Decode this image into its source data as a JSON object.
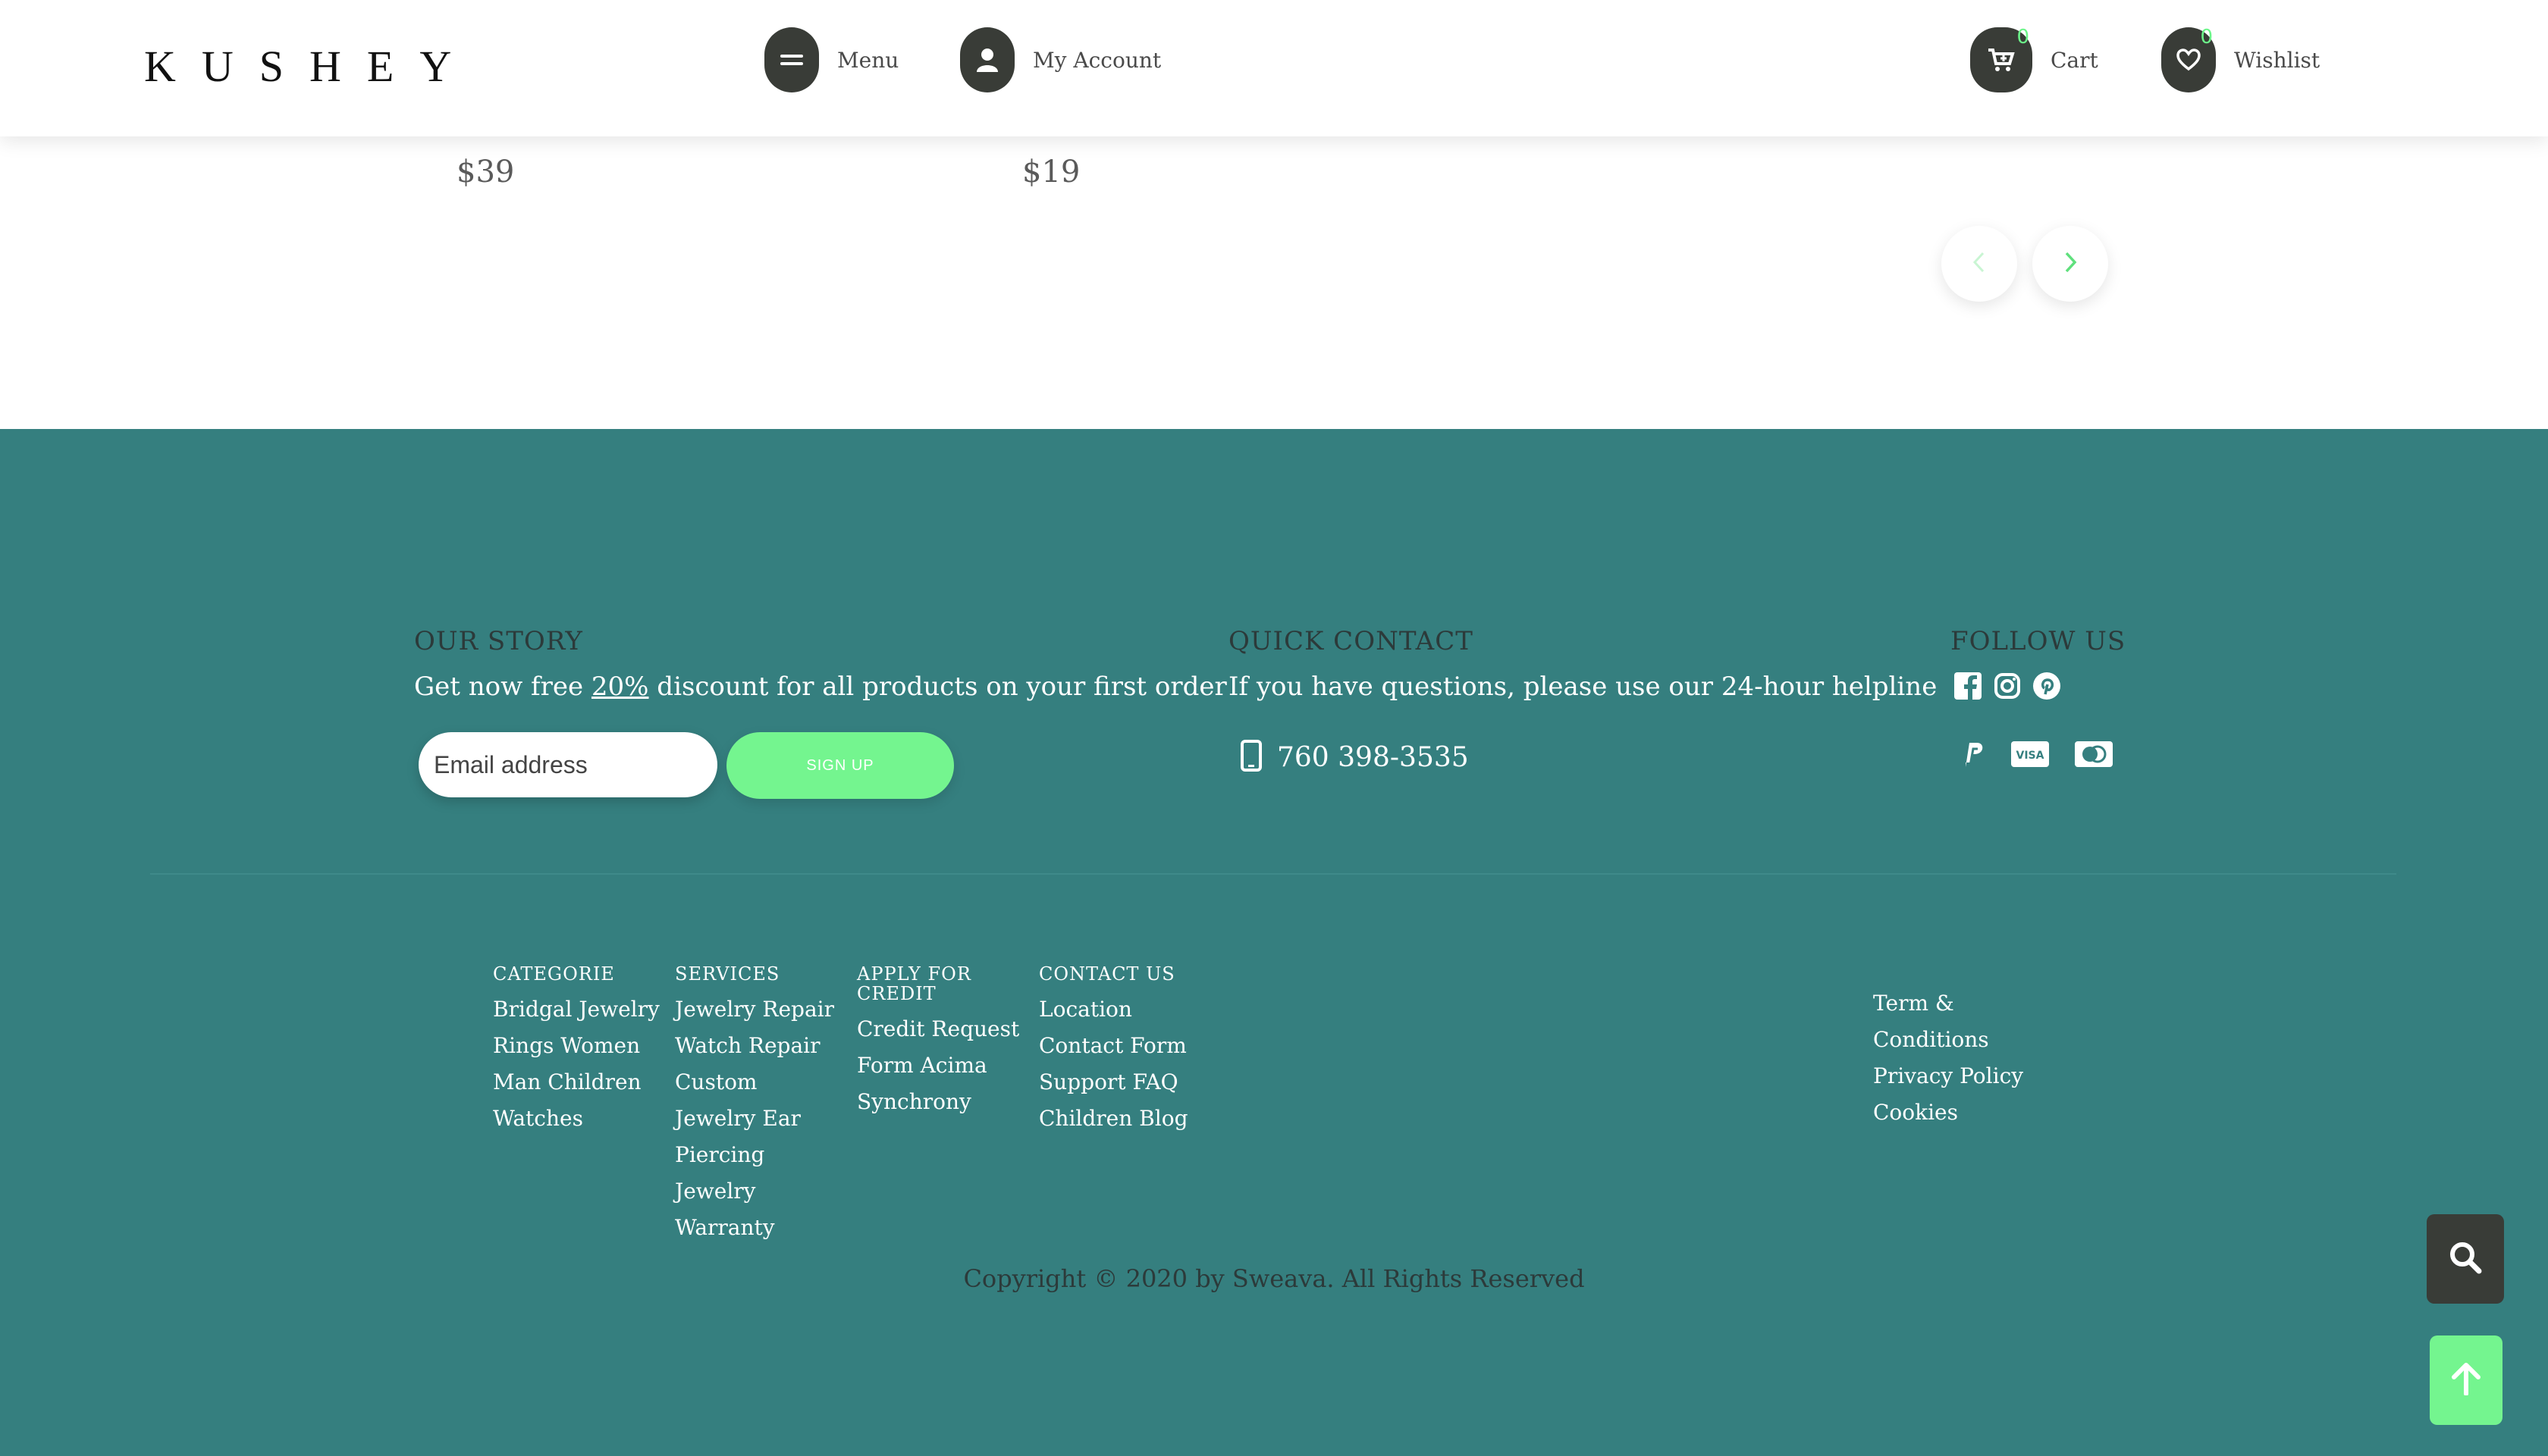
{
  "header": {
    "logo": "KUSHEY",
    "menu_label": "Menu",
    "account_label": "My Account",
    "cart_label": "Cart",
    "cart_count": "0",
    "wishlist_label": "Wishlist",
    "wishlist_count": "0"
  },
  "products": {
    "prices": [
      "$39",
      "$19"
    ],
    "carousel": {
      "prev_icon": "chevron-left-icon",
      "next_icon": "chevron-right-icon"
    }
  },
  "footer": {
    "our_story": {
      "title": "OUR STORY",
      "text_before": "Get now free ",
      "highlight": "20%",
      "text_after": " discount for all products on your first order",
      "email_placeholder": "Email address",
      "signup_label": "SIGN UP"
    },
    "quick_contact": {
      "title": "QUICK CONTACT",
      "text": "If you have questions, please use our 24-hour helpline",
      "phone": "760 398-3535"
    },
    "follow_us": {
      "title": "FOLLOW US",
      "social_icons": [
        "facebook-icon",
        "instagram-icon",
        "pinterest-icon"
      ],
      "payment_icons": [
        "paypal-icon",
        "visa-icon",
        "mastercard-icon"
      ]
    },
    "columns": [
      {
        "heading": "CATEGORIE",
        "items": [
          "Bridgal Jewelry",
          "Rings Women",
          "Man Children",
          "Watches"
        ]
      },
      {
        "heading": "SERVICES",
        "items": [
          "Jewelry Repair",
          "Watch Repair",
          "Custom",
          "Jewelry Ear",
          "Piercing",
          "Jewelry",
          "Warranty"
        ]
      },
      {
        "heading": "APPLY FOR CREDIT",
        "items": [
          "Credit Request",
          "Form Acima",
          "Synchrony"
        ]
      },
      {
        "heading": "CONTACT US",
        "items": [
          "Location",
          "Contact Form",
          "Support FAQ",
          "Children Blog"
        ]
      }
    ],
    "legal": [
      "Term &",
      "Conditions",
      "Privacy Policy",
      "Cookies"
    ],
    "copyright": "Copyright © 2020 by Sweava. All Rights Reserved"
  },
  "colors": {
    "footer_bg": "#357f7f",
    "accent_green": "#74f58f",
    "dark_button": "#393c37"
  }
}
